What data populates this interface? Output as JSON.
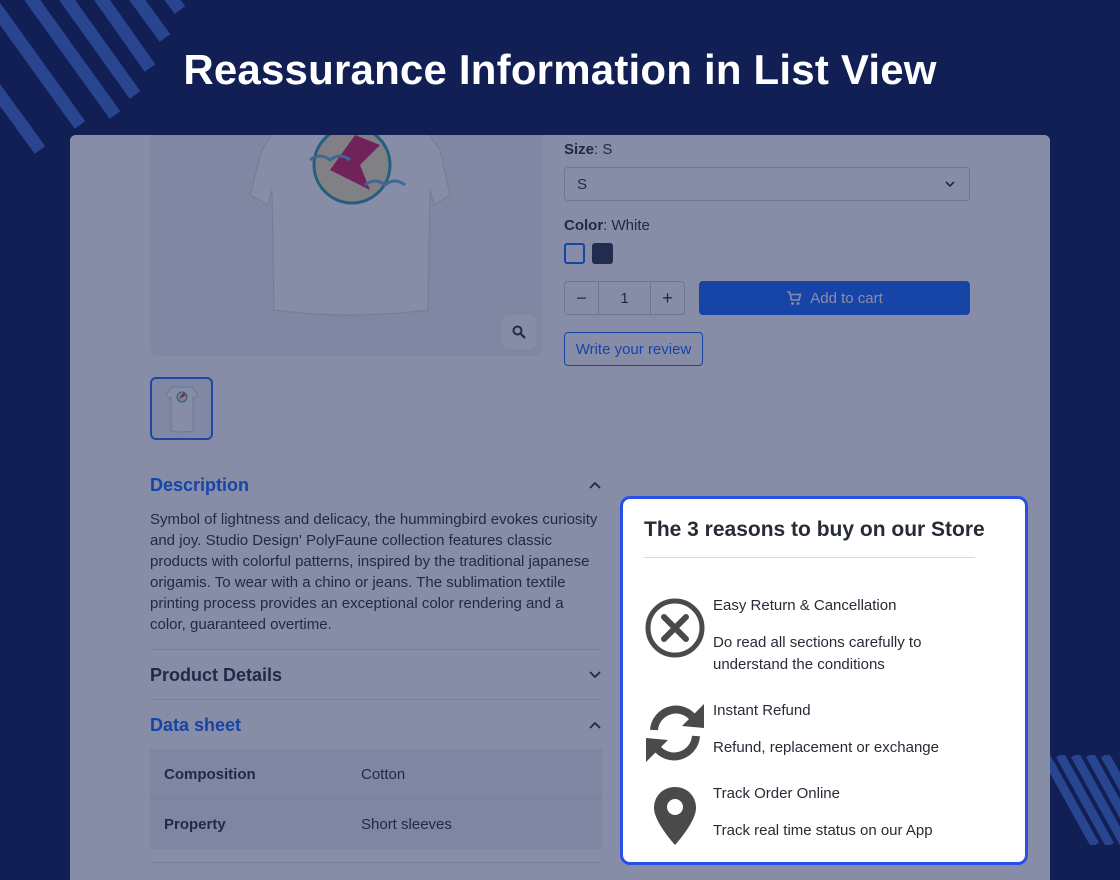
{
  "banner": {
    "title": "Reassurance Information in List View"
  },
  "product": {
    "size_label": "Size",
    "size_value": "S",
    "size_select_value": "S",
    "color_label": "Color",
    "color_value": "White",
    "swatches": [
      "#ffffff",
      "#2d3546"
    ],
    "quantity": "1",
    "qty_minus": "−",
    "qty_plus": "+",
    "add_to_cart": "Add to cart",
    "write_review": "Write your review"
  },
  "accordion": {
    "description_title": "Description",
    "description_text": "Symbol of lightness and delicacy, the hummingbird evokes curiosity and joy. Studio Design' PolyFaune collection features classic products with colorful patterns, inspired by the traditional japanese origamis. To wear with a chino or jeans. The sublimation textile printing process provides an exceptional color rendering and a color, guaranteed overtime.",
    "product_details_title": "Product Details",
    "data_sheet_title": "Data sheet",
    "data_sheet": [
      {
        "key": "Composition",
        "value": "Cotton"
      },
      {
        "key": "Property",
        "value": "Short sleeves"
      }
    ]
  },
  "reassurance": {
    "title": "The 3 reasons to buy on our Store",
    "items": [
      {
        "icon": "close-circle-icon",
        "title": "Easy Return & Cancellation",
        "desc": "Do read all sections carefully to understand the conditions"
      },
      {
        "icon": "refresh-icon",
        "title": "Instant Refund",
        "desc": "Refund, replacement or exchange"
      },
      {
        "icon": "map-pin-icon",
        "title": "Track Order Online",
        "desc": "Track real time status on our App"
      }
    ]
  },
  "colors": {
    "background": "#111f54",
    "accent": "#1666ff",
    "popup_border": "#2a4fe6"
  }
}
